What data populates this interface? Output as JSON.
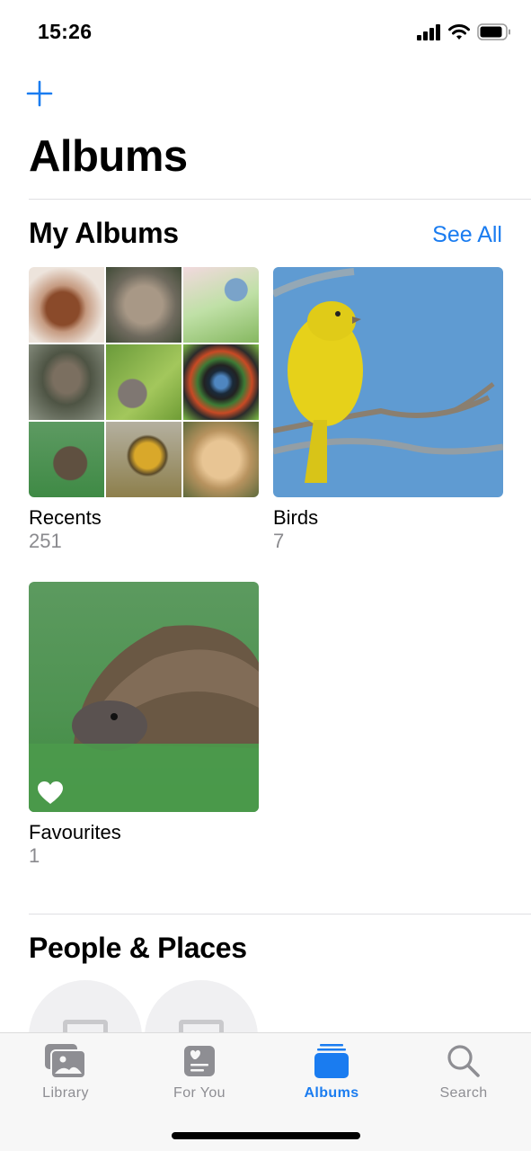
{
  "status_bar": {
    "time": "15:26",
    "icons": [
      "cellular-signal-icon",
      "wifi-icon",
      "battery-icon"
    ]
  },
  "header": {
    "add_icon": "plus-icon",
    "title": "Albums"
  },
  "my_albums": {
    "title": "My Albums",
    "see_all": "See All",
    "albums": [
      {
        "name": "Recents",
        "count": "251",
        "thumb": "mosaic"
      },
      {
        "name": "Birds",
        "count": "7",
        "thumb": "yellow-bird-on-branch"
      },
      {
        "name": "Favourites",
        "count": "1",
        "thumb": "hedgehog-in-grass",
        "badge": "heart-icon"
      }
    ],
    "recents_mosaic": [
      "kitten-sleeping",
      "tabby-cat",
      "bird-blossom",
      "cat-in-grass",
      "kitten-sitting",
      "camera-lens-art",
      "hedgehog",
      "duckling",
      "puppy"
    ]
  },
  "people_places": {
    "title": "People & Places"
  },
  "tab_bar": {
    "tabs": [
      {
        "label": "Library",
        "icon": "photo-library-icon",
        "active": false
      },
      {
        "label": "For You",
        "icon": "for-you-icon",
        "active": false
      },
      {
        "label": "Albums",
        "icon": "albums-stack-icon",
        "active": true
      },
      {
        "label": "Search",
        "icon": "search-icon",
        "active": false
      }
    ]
  },
  "colors": {
    "accent": "#1a7cf0",
    "secondary_text": "#8a8a8e",
    "tab_inactive": "#8e8e93"
  }
}
